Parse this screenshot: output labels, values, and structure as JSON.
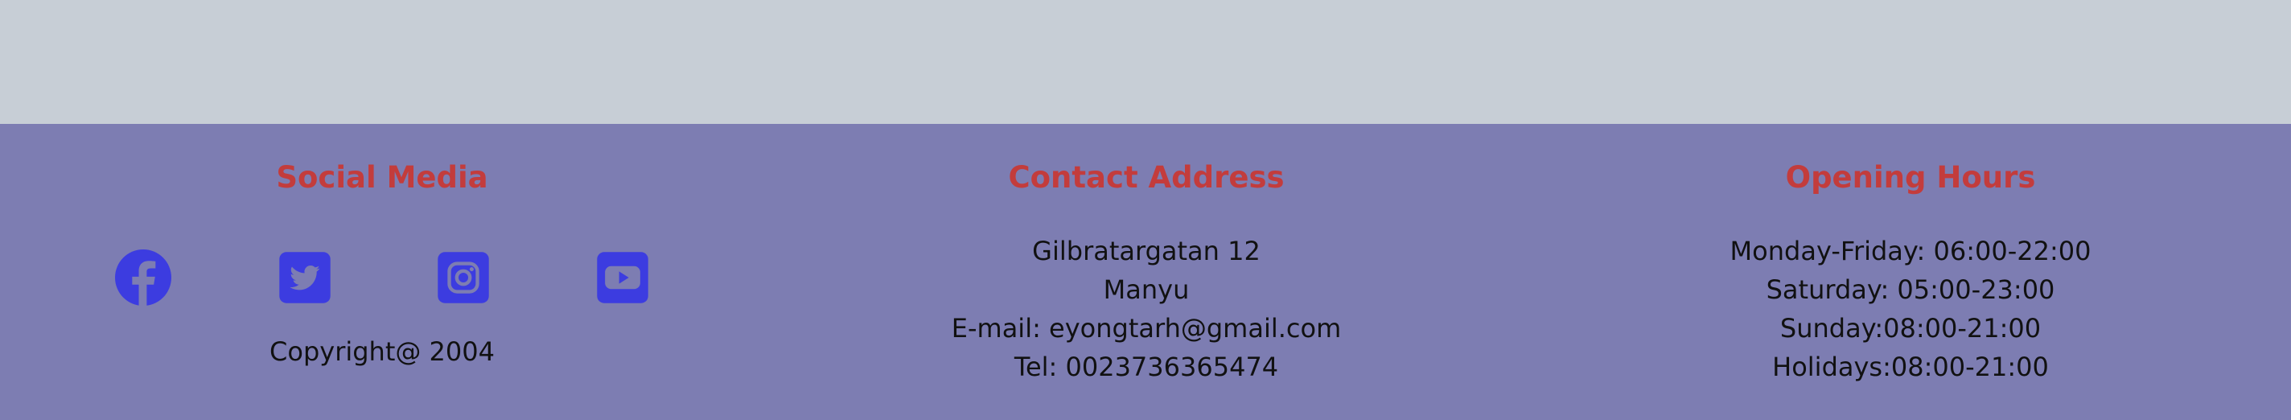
{
  "colors": {
    "top_band": "#c7ced6",
    "footer_bg": "#7d7db2",
    "heading": "#c33c3c",
    "icon": "#3c3ce0",
    "text": "#111111"
  },
  "social": {
    "heading": "Social Media",
    "icons": [
      "facebook-icon",
      "twitter-icon",
      "instagram-icon",
      "youtube-icon"
    ],
    "copyright": "Copyright@ 2004"
  },
  "contact": {
    "heading": "Contact Address",
    "street": "Gilbratargatan 12",
    "city": "Manyu",
    "email": "E-mail: eyongtarh@gmail.com",
    "phone": "Tel: 0023736365474"
  },
  "hours": {
    "heading": "Opening Hours",
    "weekdays": "Monday-Friday: 06:00-22:00",
    "saturday": "Saturday: 05:00-23:00",
    "sunday": "Sunday:08:00-21:00",
    "holidays": "Holidays:08:00-21:00"
  }
}
